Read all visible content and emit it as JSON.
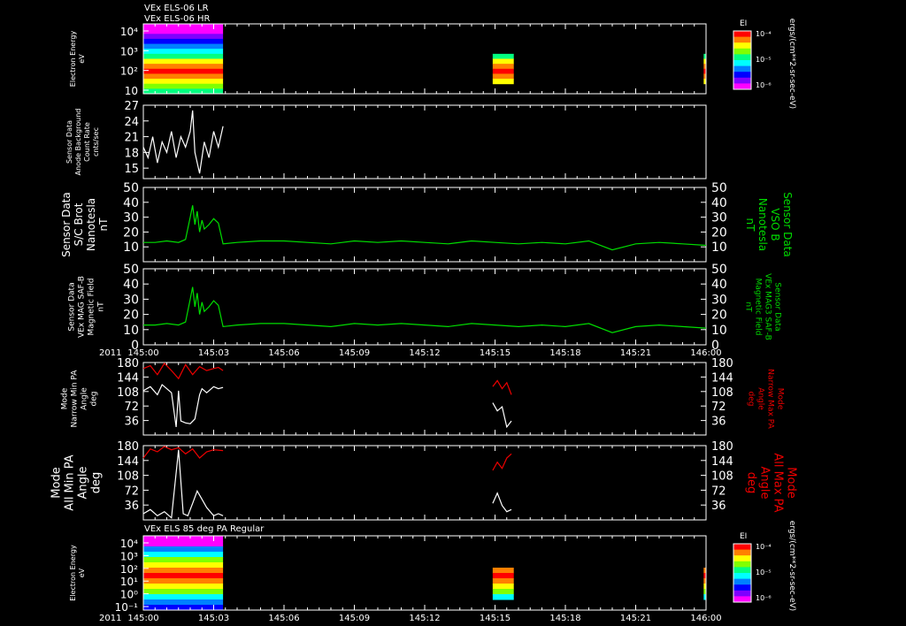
{
  "header": {
    "title_line1": "VEx ELS-06 LR",
    "title_line2": "VEx ELS-06 HR",
    "bottom_title": "VEx ELS 85 deg PA Regular"
  },
  "time_axis": {
    "year_label": "2011",
    "ticks": [
      "145:00",
      "145:03",
      "145:06",
      "145:09",
      "145:12",
      "145:15",
      "145:18",
      "145:21",
      "146:00"
    ]
  },
  "colorbar": {
    "label": "EI",
    "tick_labels": [
      "10⁻⁴",
      "10⁻⁵",
      "10⁻⁶"
    ],
    "unit": "ergs/(cm**2-sr-sec-eV)",
    "colors": [
      "#ff0000",
      "#ff8000",
      "#ffff00",
      "#80ff00",
      "#00ff80",
      "#00ffff",
      "#0080ff",
      "#0000ff",
      "#8000ff",
      "#ff00ff"
    ]
  },
  "chart_data": [
    {
      "type": "heatmap",
      "left_label": [
        "Electron Energy",
        "eV"
      ],
      "y_tick_labels": [
        "10⁴",
        "10³",
        "10²",
        "10"
      ],
      "y_scale": "log",
      "coverage_segments": [
        [
          "145:00",
          "145:03.4"
        ],
        [
          "145:14.9",
          "145:15.8"
        ],
        [
          "145:23.9",
          "146:00"
        ]
      ]
    },
    {
      "type": "line",
      "left_label": [
        "Sensor Data",
        "Anode Background",
        "Count Rate",
        "cnts/sec"
      ],
      "y_ticks": [
        15,
        18,
        21,
        24,
        27
      ],
      "ylim": [
        13,
        27
      ],
      "series": [
        {
          "color": "#ffffff",
          "x_minutes": [
            0,
            0.2,
            0.4,
            0.6,
            0.8,
            1.0,
            1.2,
            1.4,
            1.6,
            1.8,
            2.0,
            2.1,
            2.2,
            2.4,
            2.6,
            2.8,
            3.0,
            3.2,
            3.4
          ],
          "values": [
            19,
            17,
            21,
            16,
            20,
            18,
            22,
            17,
            21,
            19,
            22,
            26,
            18,
            14,
            20,
            17,
            22,
            19,
            23
          ]
        }
      ]
    },
    {
      "type": "line",
      "left_label": [
        "Sensor Data",
        "S/C Brot",
        "Nanotesla",
        "nT"
      ],
      "right_label": [
        "Sensor Data",
        "VSO B",
        "Nanotesla",
        "nT"
      ],
      "y_ticks": [
        10,
        20,
        30,
        40,
        50
      ],
      "ylim": [
        0,
        50
      ],
      "series": [
        {
          "color": "#00dd00",
          "x_minutes": [
            0,
            0.5,
            1.0,
            1.5,
            1.8,
            2.0,
            2.1,
            2.2,
            2.3,
            2.4,
            2.5,
            2.6,
            2.8,
            3.0,
            3.2,
            3.4,
            4,
            5,
            6,
            7,
            8,
            9,
            10,
            11,
            12,
            13,
            14,
            15,
            16,
            17,
            18,
            19,
            20,
            21,
            22,
            23,
            24
          ],
          "values": [
            13,
            13,
            14,
            13,
            15,
            30,
            38,
            25,
            34,
            20,
            28,
            22,
            25,
            29,
            26,
            12,
            13,
            14,
            14,
            13,
            12,
            14,
            13,
            14,
            13,
            12,
            14,
            13,
            12,
            13,
            12,
            14,
            8,
            12,
            13,
            12,
            11
          ]
        }
      ]
    },
    {
      "type": "line",
      "left_label": [
        "Sensor Data",
        "VEx MAG SAF-B",
        "Magnetic Field",
        "nT"
      ],
      "right_label": [
        "Sensor Data",
        "VEx MAG3 SAF-B",
        "Magnetic Field",
        "nT"
      ],
      "y_ticks": [
        0,
        10,
        20,
        30,
        40,
        50
      ],
      "ylim": [
        0,
        50
      ],
      "series": [
        {
          "color": "#00dd00",
          "x_minutes": [
            0,
            0.5,
            1.0,
            1.5,
            1.8,
            2.0,
            2.1,
            2.2,
            2.3,
            2.4,
            2.5,
            2.6,
            2.8,
            3.0,
            3.2,
            3.4,
            4,
            5,
            6,
            7,
            8,
            9,
            10,
            11,
            12,
            13,
            14,
            15,
            16,
            17,
            18,
            19,
            20,
            21,
            22,
            23,
            24
          ],
          "values": [
            13,
            13,
            14,
            13,
            15,
            30,
            38,
            25,
            34,
            20,
            28,
            22,
            25,
            29,
            26,
            12,
            13,
            14,
            14,
            13,
            12,
            14,
            13,
            14,
            13,
            12,
            14,
            13,
            12,
            13,
            12,
            14,
            8,
            12,
            13,
            12,
            11
          ]
        }
      ]
    },
    {
      "type": "line",
      "left_label": [
        "Mode",
        "Narrow Min PA",
        "Angle",
        "deg"
      ],
      "right_label": [
        "Mode",
        "Narrow Max PA",
        "Angle",
        "deg"
      ],
      "y_ticks": [
        36,
        72,
        108,
        144,
        180
      ],
      "ylim": [
        0,
        180
      ],
      "series": [
        {
          "color": "#ffffff",
          "segments": [
            {
              "x_minutes": [
                0,
                0.3,
                0.6,
                0.8,
                1.0,
                1.2,
                1.4,
                1.5,
                1.6,
                1.8,
                2.0,
                2.2,
                2.4,
                2.5,
                2.7,
                3.0,
                3.2,
                3.4
              ],
              "values": [
                110,
                120,
                100,
                125,
                115,
                105,
                20,
                110,
                35,
                30,
                28,
                40,
                100,
                115,
                105,
                120,
                115,
                118
              ]
            },
            {
              "x_minutes": [
                14.9,
                15.1,
                15.3,
                15.5,
                15.7
              ],
              "values": [
                80,
                60,
                70,
                20,
                35
              ]
            }
          ]
        },
        {
          "color": "#ee0000",
          "segments": [
            {
              "x_minutes": [
                0,
                0.3,
                0.6,
                0.9,
                1.2,
                1.5,
                1.8,
                2.1,
                2.4,
                2.7,
                3.0,
                3.2,
                3.4
              ],
              "values": [
                165,
                172,
                150,
                178,
                160,
                140,
                175,
                150,
                170,
                160,
                165,
                168,
                160
              ]
            },
            {
              "x_minutes": [
                14.9,
                15.1,
                15.3,
                15.5,
                15.7
              ],
              "values": [
                120,
                135,
                115,
                130,
                100
              ]
            }
          ]
        }
      ]
    },
    {
      "type": "line",
      "left_label": [
        "Mode",
        "All Min PA",
        "Angle",
        "deg"
      ],
      "right_label": [
        "Mode",
        "All Max PA",
        "Angle",
        "deg"
      ],
      "y_ticks": [
        36,
        72,
        108,
        144,
        180
      ],
      "ylim": [
        0,
        180
      ],
      "series": [
        {
          "color": "#ffffff",
          "segments": [
            {
              "x_minutes": [
                0,
                0.3,
                0.6,
                0.9,
                1.2,
                1.5,
                1.7,
                1.9,
                2.1,
                2.3,
                2.5,
                2.7,
                3.0,
                3.2,
                3.4
              ],
              "values": [
                15,
                25,
                10,
                20,
                5,
                170,
                15,
                10,
                40,
                70,
                50,
                30,
                10,
                15,
                10
              ]
            },
            {
              "x_minutes": [
                14.9,
                15.1,
                15.3,
                15.5,
                15.7
              ],
              "values": [
                40,
                65,
                35,
                20,
                25
              ]
            }
          ]
        },
        {
          "color": "#ee0000",
          "segments": [
            {
              "x_minutes": [
                0,
                0.3,
                0.6,
                0.9,
                1.2,
                1.5,
                1.8,
                2.1,
                2.4,
                2.7,
                3.0,
                3.4
              ],
              "values": [
                150,
                172,
                165,
                178,
                170,
                175,
                160,
                172,
                150,
                165,
                170,
                168
              ]
            },
            {
              "x_minutes": [
                14.9,
                15.1,
                15.3,
                15.5,
                15.7
              ],
              "values": [
                120,
                140,
                125,
                150,
                160
              ]
            }
          ]
        }
      ]
    },
    {
      "type": "heatmap",
      "left_label": [
        "Electron Energy",
        "eV"
      ],
      "y_tick_labels": [
        "10⁴",
        "10³",
        "10²",
        "10¹",
        "10⁰",
        "10⁻¹"
      ],
      "y_scale": "log",
      "coverage_segments": [
        [
          "145:00",
          "145:03.4"
        ],
        [
          "145:14.9",
          "145:15.8"
        ],
        [
          "145:23.9",
          "146:00"
        ]
      ]
    }
  ]
}
